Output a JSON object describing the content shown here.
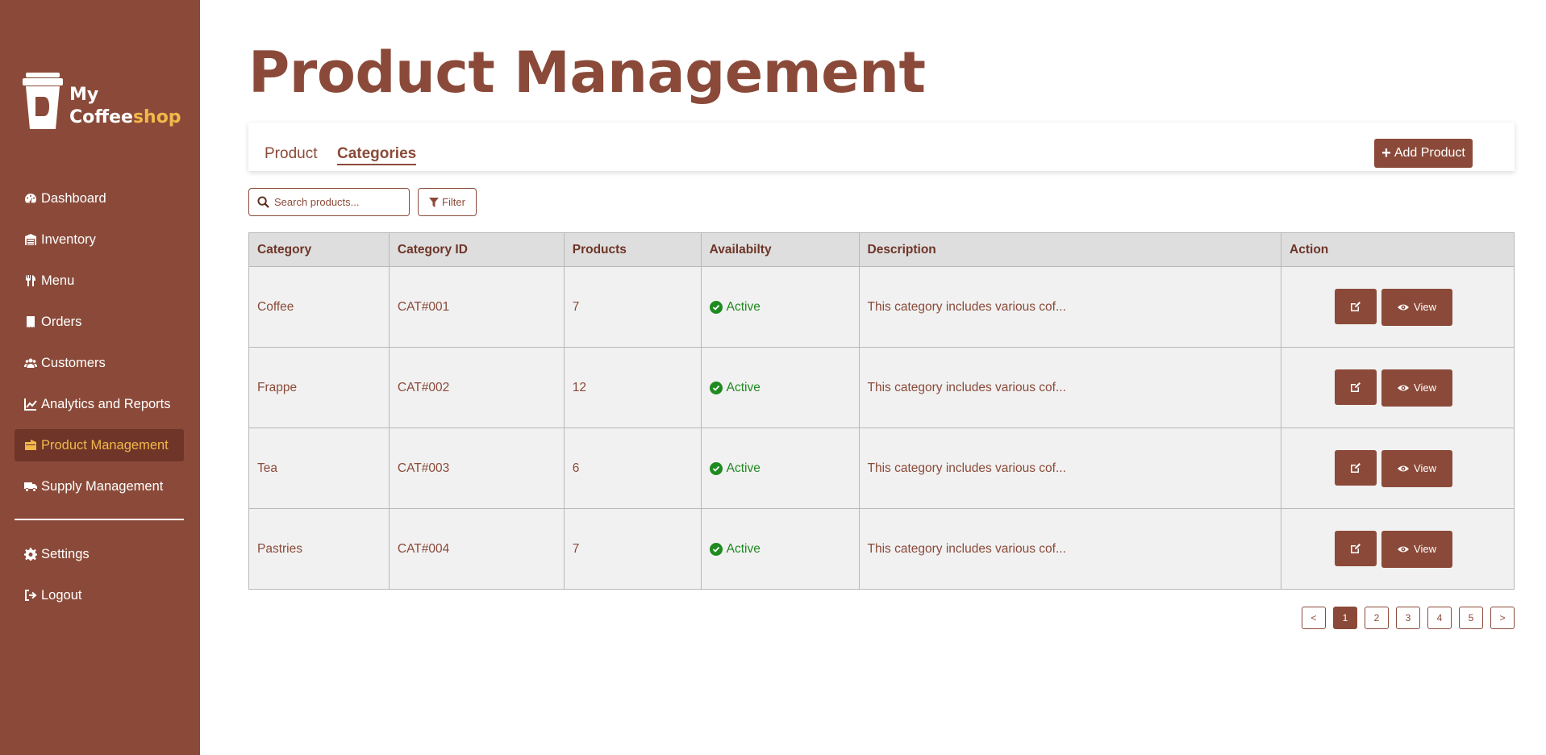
{
  "brand": {
    "line1": "My",
    "line2a": "Coffee",
    "line2b": "shop"
  },
  "sidebar": {
    "items": [
      {
        "label": "Dashboard",
        "icon": "dashboard-icon"
      },
      {
        "label": "Inventory",
        "icon": "warehouse-icon"
      },
      {
        "label": "Menu",
        "icon": "utensils-icon"
      },
      {
        "label": "Orders",
        "icon": "receipt-icon"
      },
      {
        "label": "Customers",
        "icon": "users-icon"
      },
      {
        "label": "Analytics and Reports",
        "icon": "chart-line-icon"
      },
      {
        "label": "Product Management",
        "icon": "box-icon",
        "active": true
      },
      {
        "label": "Supply Management",
        "icon": "truck-icon"
      }
    ],
    "bottom": [
      {
        "label": "Settings",
        "icon": "gear-icon"
      },
      {
        "label": "Logout",
        "icon": "logout-icon"
      }
    ]
  },
  "main": {
    "title": "Product Management",
    "tabs": [
      {
        "label": "Product"
      },
      {
        "label": "Categories",
        "active": true
      }
    ],
    "add_button": "Add Product",
    "search": {
      "placeholder": "Search products..."
    },
    "filter_label": "Filter",
    "table": {
      "headers": [
        "Category",
        "Category ID",
        "Products",
        "Availabilty",
        "Description",
        "Action"
      ],
      "rows": [
        {
          "category": "Coffee",
          "id": "CAT#001",
          "products": "7",
          "status": "Active",
          "description": "This category includes various cof..."
        },
        {
          "category": "Frappe",
          "id": "CAT#002",
          "products": "12",
          "status": "Active",
          "description": "This category includes various cof..."
        },
        {
          "category": "Tea",
          "id": "CAT#003",
          "products": "6",
          "status": "Active",
          "description": "This category includes various cof..."
        },
        {
          "category": "Pastries",
          "id": "CAT#004",
          "products": "7",
          "status": "Active",
          "description": "This category includes various cof..."
        }
      ],
      "view_label": "View"
    },
    "pagination": {
      "prev": "<",
      "next": ">",
      "pages": [
        "1",
        "2",
        "3",
        "4",
        "5"
      ],
      "current": "1"
    }
  },
  "colors": {
    "brand": "#8b4a39",
    "accent": "#f2b84b",
    "status_active": "#1f8a1f"
  }
}
